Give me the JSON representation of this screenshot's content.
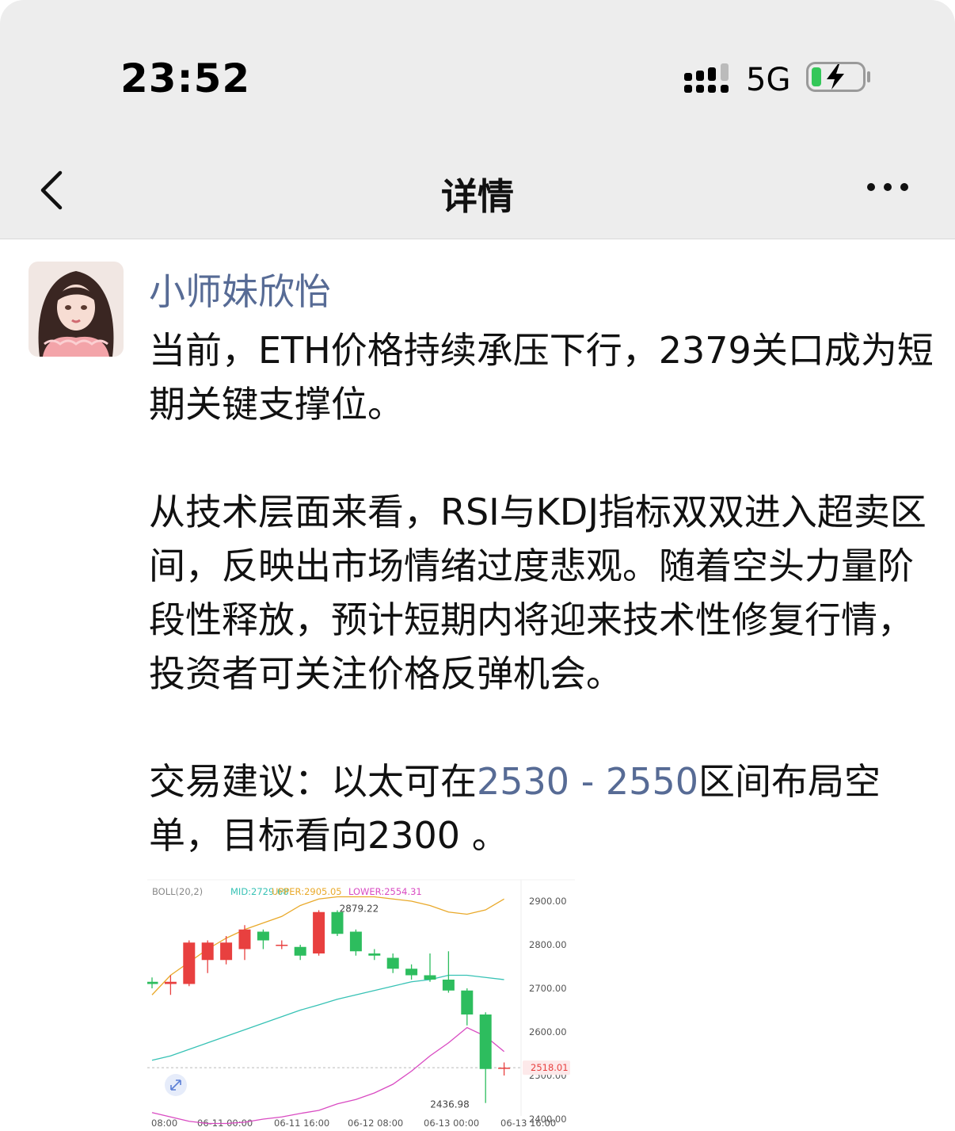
{
  "status_bar": {
    "time": "23:52",
    "network": "5G",
    "battery_charging": true,
    "signal_icon": "signal-bars-icon",
    "battery_icon": "battery-charging-icon"
  },
  "nav": {
    "title": "详情",
    "back_icon": "chevron-left-icon",
    "more_icon": "more-horizontal-icon"
  },
  "post": {
    "author": "小师妹欣怡",
    "paragraphs": [
      "当前，ETH价格持续承压下行，2379关口成为短期关键支撑位。",
      "从技术层面来看，RSI与KDJ指标双双进入超卖区间，反映出市场情绪过度悲观。随着空头力量阶段性释放，预计短期内将迎来技术性修复行情，投资者可关注价格反弹机会。"
    ],
    "advice_prefix": "交易建议：以太可在",
    "advice_range": "2530 - 2550",
    "advice_suffix": "区间布局空单，目标看向2300 。"
  },
  "colors": {
    "link": "#576b95",
    "up": "#e8403f",
    "down": "#2dbd5e",
    "mid": "#37c2b5",
    "upper": "#e9a92a",
    "lower": "#d94bc2"
  },
  "chart_data": {
    "type": "candlestick",
    "indicator": {
      "name": "BOLL(20,2)",
      "mid": "MID:2729.68",
      "upper": "UPPER:2905.05",
      "lower": "LOWER:2554.31"
    },
    "y_ticks": [
      2900,
      2800,
      2700,
      2600,
      2500,
      2400
    ],
    "ylim": [
      2380,
      2960
    ],
    "x_tick_labels": [
      "08:00",
      "06-11 00:00",
      "06-11 16:00",
      "06-12 08:00",
      "06-13 00:00",
      "06-13 16:00"
    ],
    "candles": [
      {
        "o": 2715,
        "c": 2710,
        "h": 2725,
        "l": 2700
      },
      {
        "o": 2710,
        "c": 2715,
        "h": 2730,
        "l": 2685
      },
      {
        "o": 2710,
        "c": 2805,
        "h": 2810,
        "l": 2705
      },
      {
        "o": 2765,
        "c": 2805,
        "h": 2810,
        "l": 2735
      },
      {
        "o": 2765,
        "c": 2805,
        "h": 2820,
        "l": 2755
      },
      {
        "o": 2790,
        "c": 2835,
        "h": 2845,
        "l": 2765
      },
      {
        "o": 2830,
        "c": 2810,
        "h": 2835,
        "l": 2790
      },
      {
        "o": 2800,
        "c": 2800,
        "h": 2810,
        "l": 2790
      },
      {
        "o": 2795,
        "c": 2775,
        "h": 2800,
        "l": 2765
      },
      {
        "o": 2780,
        "c": 2875,
        "h": 2879.22,
        "l": 2775
      },
      {
        "o": 2875,
        "c": 2825,
        "h": 2879,
        "l": 2820
      },
      {
        "o": 2830,
        "c": 2785,
        "h": 2835,
        "l": 2775
      },
      {
        "o": 2780,
        "c": 2775,
        "h": 2790,
        "l": 2765
      },
      {
        "o": 2770,
        "c": 2745,
        "h": 2780,
        "l": 2735
      },
      {
        "o": 2745,
        "c": 2730,
        "h": 2755,
        "l": 2720
      },
      {
        "o": 2730,
        "c": 2720,
        "h": 2780,
        "l": 2715
      },
      {
        "o": 2720,
        "c": 2695,
        "h": 2785,
        "l": 2690
      },
      {
        "o": 2695,
        "c": 2640,
        "h": 2700,
        "l": 2615
      },
      {
        "o": 2640,
        "c": 2515,
        "h": 2645,
        "l": 2436.98
      },
      {
        "o": 2518,
        "c": 2518.01,
        "h": 2530,
        "l": 2500
      }
    ],
    "mid_line": [
      2535,
      2545,
      2560,
      2575,
      2590,
      2605,
      2620,
      2635,
      2650,
      2662,
      2675,
      2685,
      2695,
      2705,
      2715,
      2720,
      2730,
      2730,
      2725,
      2720
    ],
    "upper_line": [
      2685,
      2730,
      2760,
      2790,
      2815,
      2835,
      2850,
      2865,
      2890,
      2905,
      2910,
      2910,
      2910,
      2905,
      2900,
      2890,
      2875,
      2870,
      2880,
      2905
    ],
    "lower_line": [
      2415,
      2405,
      2395,
      2390,
      2390,
      2393,
      2400,
      2405,
      2413,
      2420,
      2435,
      2445,
      2460,
      2480,
      2510,
      2545,
      2575,
      2610,
      2590,
      2555
    ],
    "max_label": "2879.22",
    "min_label": "2436.98",
    "last_price": "2518.01"
  }
}
